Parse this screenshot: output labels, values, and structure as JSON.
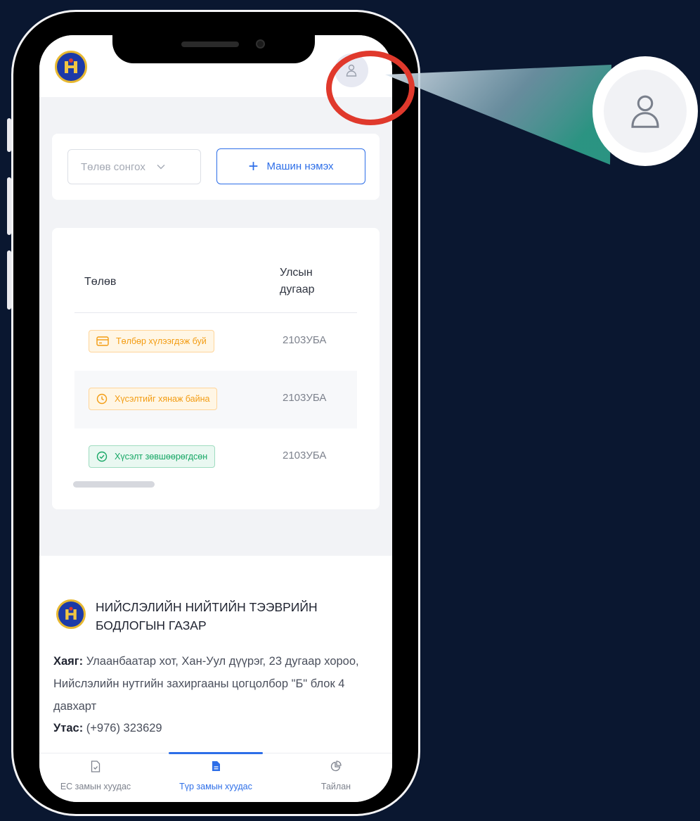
{
  "header": {
    "logo_icon": "emblem-logo",
    "profile_icon": "user-icon"
  },
  "filter": {
    "status_placeholder": "Төлөв сонгох",
    "add_car_label": "Машин нэмэх"
  },
  "table": {
    "columns": [
      "Төлөв",
      "Улсын дугаар"
    ],
    "rows": [
      {
        "status": "Төлбөр хүлээгдэж буй",
        "status_color": "#f39c12",
        "status_icon": "card-icon",
        "plate": "2103УБА"
      },
      {
        "status": "Хүсэлтийг хянаж байна",
        "status_color": "#f39c12",
        "status_icon": "clock-icon",
        "plate": "2103УБА"
      },
      {
        "status": "Хүсэлт зөвшөөрөгдсөн",
        "status_color": "#17a765",
        "status_icon": "check-circle-icon",
        "plate": "2103УБА"
      }
    ]
  },
  "footer": {
    "org_name": "НИЙСЛЭЛИЙН НИЙТИЙН ТЭЭВРИЙН БОДЛОГЫН ГАЗАР",
    "address_label": "Хаяг:",
    "address_value": "Улаанбаатар хот, Хан-Уул дүүрэг, 23 дугаар хороо, Нийслэлийн нутгийн захиргааны цогцолбор \"Б\" блок 4 давхарт",
    "phone_label": "Утас:",
    "phone_value": "(+976) 323629"
  },
  "bottom_nav": {
    "items": [
      {
        "label": "ЕС замын хуудас",
        "icon": "document-icon",
        "active": false
      },
      {
        "label": "Түр замын хуудас",
        "icon": "file-filled-icon",
        "active": true
      },
      {
        "label": "Тайлан",
        "icon": "pie-chart-icon",
        "active": false
      }
    ]
  },
  "colors": {
    "background": "#0a1730",
    "accent": "#2d6ee8",
    "highlight_ring": "#e0392c",
    "pending": "#f39c12",
    "approved": "#17a765"
  }
}
